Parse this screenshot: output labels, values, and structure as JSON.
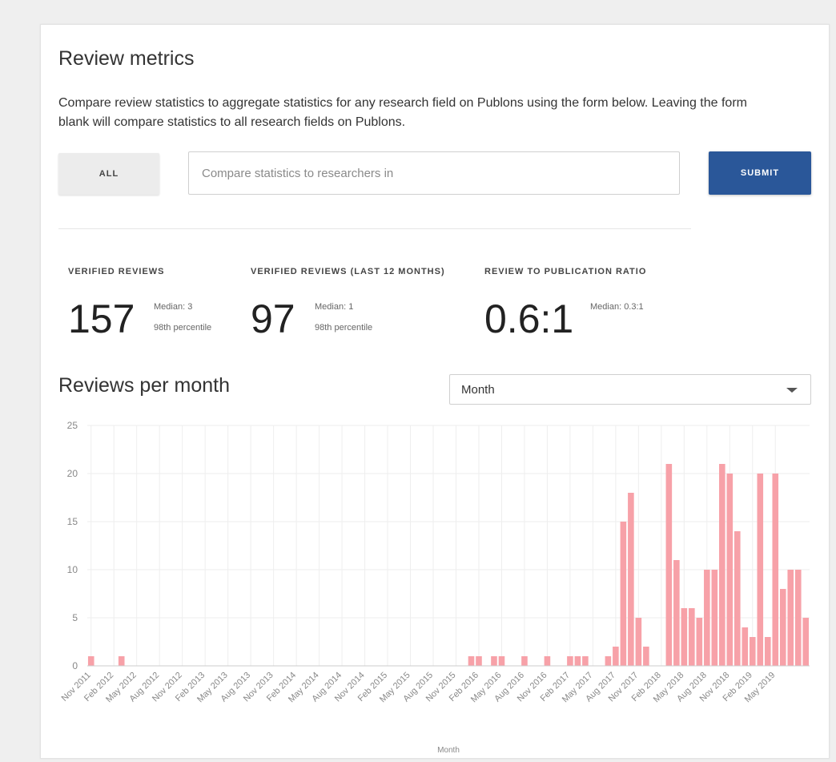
{
  "header": {
    "title": "Review metrics",
    "description": "Compare review statistics to aggregate statistics for any research field on Publons using the form below. Leaving the form blank will compare statistics to all research fields on Publons."
  },
  "form": {
    "all_label": "ALL",
    "search_placeholder": "Compare statistics to researchers in",
    "submit_label": "SUBMIT"
  },
  "metrics": [
    {
      "label": "VERIFIED REVIEWS",
      "value": "157",
      "median": "Median: 3",
      "percentile": "98th percentile"
    },
    {
      "label": "VERIFIED REVIEWS (LAST 12 MONTHS)",
      "value": "97",
      "median": "Median: 1",
      "percentile": "98th percentile"
    },
    {
      "label": "REVIEW TO PUBLICATION RATIO",
      "value": "0.6:1",
      "median": "Median: 0.3:1",
      "percentile": ""
    }
  ],
  "chart_section": {
    "title": "Reviews per month",
    "select_value": "Month"
  },
  "colors": {
    "bar": "#f7a1a8",
    "submit_button": "#2a5799"
  },
  "chart_data": {
    "type": "bar",
    "title": "",
    "xlabel": "Month",
    "ylabel": "",
    "ylim": [
      0,
      25
    ],
    "yticks": [
      0,
      5,
      10,
      15,
      20,
      25
    ],
    "xtick_labels": [
      "Nov 2011",
      "Feb 2012",
      "May 2012",
      "Aug 2012",
      "Nov 2012",
      "Feb 2013",
      "May 2013",
      "Aug 2013",
      "Nov 2013",
      "Feb 2014",
      "May 2014",
      "Aug 2014",
      "Nov 2014",
      "Feb 2015",
      "May 2015",
      "Aug 2015",
      "Nov 2015",
      "Feb 2016",
      "May 2016",
      "Aug 2016",
      "Nov 2016",
      "Feb 2017",
      "May 2017",
      "Aug 2017",
      "Nov 2017",
      "Feb 2018",
      "May 2018",
      "Aug 2018",
      "Nov 2018",
      "Feb 2019",
      "May 2019"
    ],
    "categories": [
      "2011-11",
      "2011-12",
      "2012-01",
      "2012-02",
      "2012-03",
      "2012-04",
      "2012-05",
      "2012-06",
      "2012-07",
      "2012-08",
      "2012-09",
      "2012-10",
      "2012-11",
      "2012-12",
      "2013-01",
      "2013-02",
      "2013-03",
      "2013-04",
      "2013-05",
      "2013-06",
      "2013-07",
      "2013-08",
      "2013-09",
      "2013-10",
      "2013-11",
      "2013-12",
      "2014-01",
      "2014-02",
      "2014-03",
      "2014-04",
      "2014-05",
      "2014-06",
      "2014-07",
      "2014-08",
      "2014-09",
      "2014-10",
      "2014-11",
      "2014-12",
      "2015-01",
      "2015-02",
      "2015-03",
      "2015-04",
      "2015-05",
      "2015-06",
      "2015-07",
      "2015-08",
      "2015-09",
      "2015-10",
      "2015-11",
      "2015-12",
      "2016-01",
      "2016-02",
      "2016-03",
      "2016-04",
      "2016-05",
      "2016-06",
      "2016-07",
      "2016-08",
      "2016-09",
      "2016-10",
      "2016-11",
      "2016-12",
      "2017-01",
      "2017-02",
      "2017-03",
      "2017-04",
      "2017-05",
      "2017-06",
      "2017-07",
      "2017-08",
      "2017-09",
      "2017-10",
      "2017-11",
      "2017-12",
      "2018-01",
      "2018-02",
      "2018-03",
      "2018-04",
      "2018-05",
      "2018-06",
      "2018-07",
      "2018-08",
      "2018-09",
      "2018-10",
      "2018-11",
      "2018-12",
      "2019-01",
      "2019-02",
      "2019-03",
      "2019-04",
      "2019-05",
      "2019-06"
    ],
    "values": [
      1,
      0,
      0,
      0,
      1,
      0,
      0,
      0,
      0,
      0,
      0,
      0,
      0,
      0,
      0,
      0,
      0,
      0,
      0,
      0,
      0,
      0,
      0,
      0,
      0,
      0,
      0,
      0,
      0,
      0,
      0,
      0,
      0,
      0,
      0,
      0,
      0,
      0,
      0,
      0,
      0,
      0,
      0,
      0,
      0,
      0,
      0,
      0,
      0,
      0,
      1,
      1,
      0,
      1,
      1,
      0,
      0,
      1,
      0,
      0,
      1,
      0,
      0,
      1,
      1,
      1,
      0,
      0,
      1,
      2,
      15,
      18,
      5,
      2,
      0,
      0,
      21,
      11,
      6,
      6,
      5,
      10,
      10,
      21,
      20,
      14,
      4,
      3,
      20,
      3,
      20,
      8,
      10,
      10,
      5
    ]
  }
}
